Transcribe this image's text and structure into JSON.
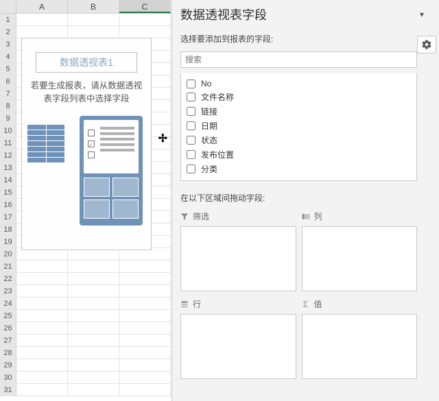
{
  "sheet": {
    "columns": [
      "A",
      "B",
      "C"
    ],
    "active_column_index": 2,
    "row_count": 31
  },
  "pivot_placeholder": {
    "title": "数据透视表1",
    "hint_line1": "若要生成报表，请从数据透视",
    "hint_line2": "表字段列表中选择字段"
  },
  "pane": {
    "title": "数据透视表字段",
    "subtitle": "选择要添加到报表的字段:",
    "search_placeholder": "搜索",
    "fields": [
      {
        "label": "No"
      },
      {
        "label": "文件名称"
      },
      {
        "label": "链接"
      },
      {
        "label": "日期"
      },
      {
        "label": "状态"
      },
      {
        "label": "发布位置"
      },
      {
        "label": "分类"
      }
    ],
    "areas_hint": "在以下区域间拖动字段:",
    "areas": {
      "filter": "筛选",
      "columns": "列",
      "rows": "行",
      "values": "值"
    }
  }
}
